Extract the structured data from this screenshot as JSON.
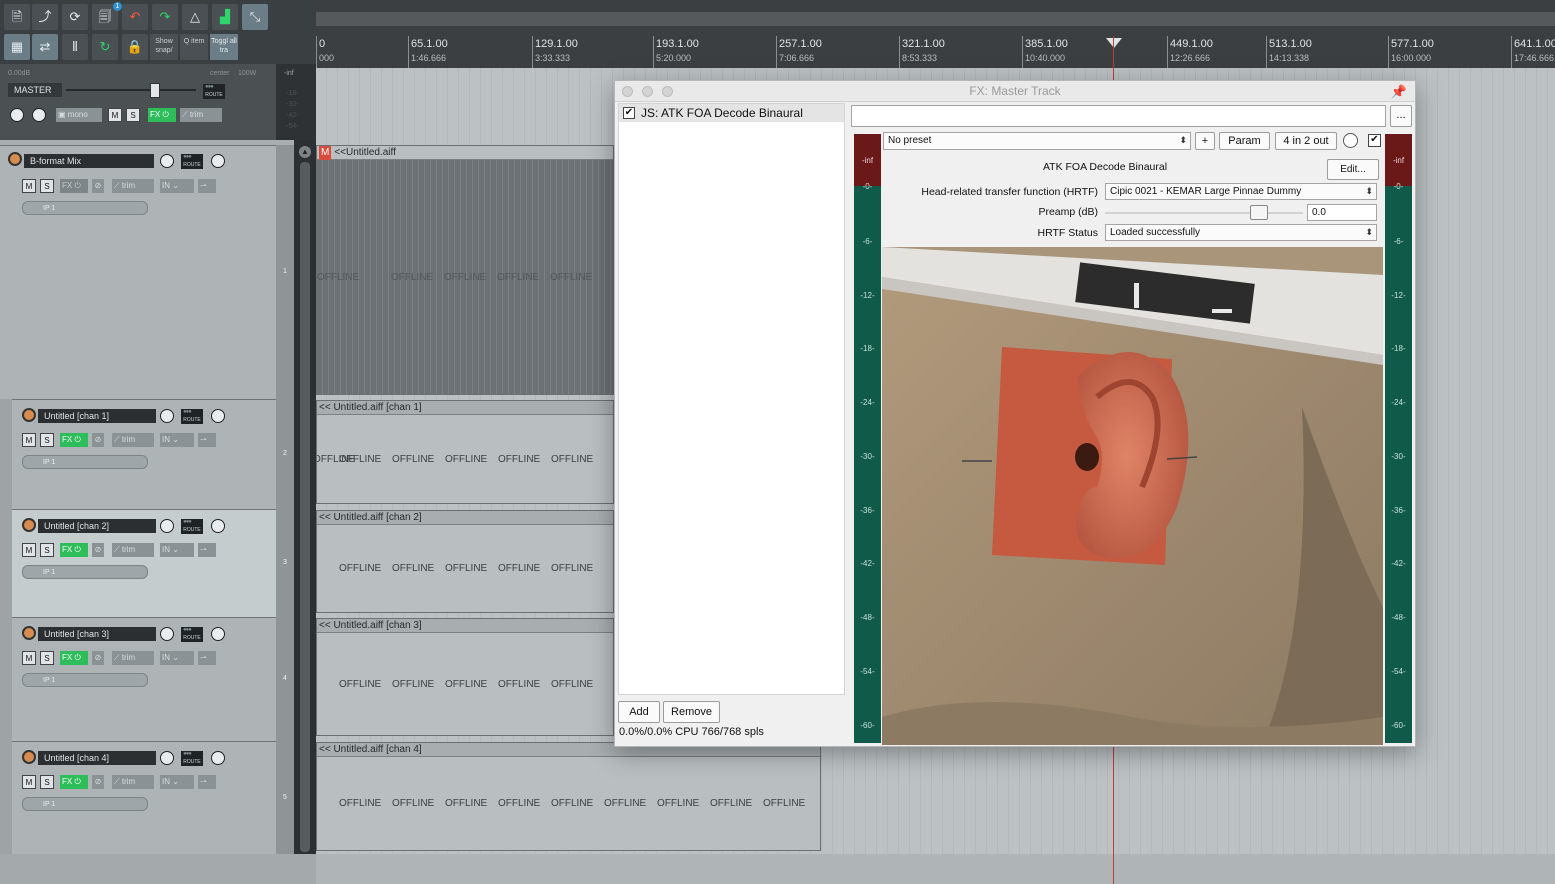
{
  "ruler": {
    "ticks": [
      {
        "label": "0",
        "sub": "000"
      },
      {
        "label": "65.1.00",
        "sub": "1:46.666"
      },
      {
        "label": "129.1.00",
        "sub": "3:33.333"
      },
      {
        "label": "193.1.00",
        "sub": "5:20.000"
      },
      {
        "label": "257.1.00",
        "sub": "7:06.666"
      },
      {
        "label": "321.1.00",
        "sub": "8:53.333"
      },
      {
        "label": "385.1.00",
        "sub": "10:40.000"
      },
      {
        "label": "449.1.00",
        "sub": "12:26.666"
      },
      {
        "label": "513.1.00",
        "sub": "14:13.338"
      },
      {
        "label": "577.1.00",
        "sub": "16:00.000"
      },
      {
        "label": "641.1.00",
        "sub": "17:46.666"
      }
    ]
  },
  "toolbar": {
    "show_snap": "Show snap/",
    "q_item": "Q item",
    "toggle_all": "Toggl all tra",
    "badge": "1"
  },
  "master": {
    "volume": "0.00dB",
    "pan": "center",
    "width": "100W",
    "name": "MASTER",
    "route": "ROUTE",
    "mono": "mono",
    "m": "M",
    "s": "S",
    "fx": "FX",
    "trim": "trim",
    "meter_ticks": [
      "-inf",
      "-18-",
      "-30-",
      "-42-",
      "-54-"
    ]
  },
  "tracks": [
    {
      "name": "B-format Mix",
      "num": "1",
      "input": "IP 1",
      "fx_active": false
    },
    {
      "name": "Untitled [chan 1]",
      "num": "2",
      "input": "IP 1",
      "fx_active": true
    },
    {
      "name": "Untitled [chan 2]",
      "num": "3",
      "input": "IP 1",
      "fx_active": true
    },
    {
      "name": "Untitled [chan 3]",
      "num": "4",
      "input": "IP 1",
      "fx_active": true
    },
    {
      "name": "Untitled [chan 4]",
      "num": "5",
      "input": "IP 1",
      "fx_active": true
    }
  ],
  "track_labels": {
    "m": "M",
    "s": "S",
    "fx": "FX",
    "trim": "trim",
    "in": "IN",
    "route": "ROUTE"
  },
  "items": [
    {
      "title": "<<Untitled.aiff"
    },
    {
      "title": "<< Untitled.aiff [chan 1]"
    },
    {
      "title": "<< Untitled.aiff [chan 2]"
    },
    {
      "title": "<< Untitled.aiff [chan 3]"
    },
    {
      "title": "<< Untitled.aiff [chan 4]"
    }
  ],
  "offline_text": "OFFLINE",
  "item_marker": "M",
  "fx_window": {
    "title": "FX: Master Track",
    "fx_list": [
      "JS: ATK FOA Decode Binaural"
    ],
    "add": "Add",
    "remove": "Remove",
    "cpu": "0.0%/0.0% CPU 766/768 spls",
    "top_field": "",
    "more": "...",
    "preset": "No preset",
    "plus": "+",
    "param": "Param",
    "io": "4 in 2 out",
    "plugin_name": "ATK FOA Decode Binaural",
    "edit": "Edit...",
    "params": [
      {
        "label": "Head-related transfer function (HRTF)",
        "value": "Cipic 0021 - KEMAR Large Pinnae Dummy"
      },
      {
        "label": "Preamp (dB)",
        "value": "0.0"
      },
      {
        "label": "HRTF Status",
        "value": "Loaded successfully"
      }
    ],
    "meter_ticks": [
      "-inf",
      "-0-",
      "-6-",
      "-12-",
      "-18-",
      "-24-",
      "-30-",
      "-36-",
      "-42-",
      "-48-",
      "-54-",
      "-60-"
    ]
  }
}
